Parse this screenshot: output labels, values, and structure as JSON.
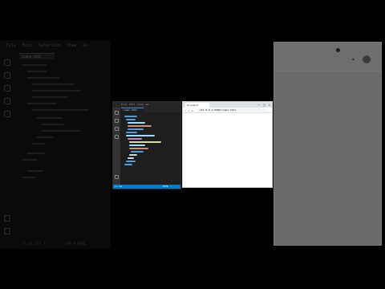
{
  "background_editor": {
    "menu": [
      "File",
      "Edit",
      "Selection",
      "View",
      "Go"
    ],
    "tab_label": "index.html",
    "status_left": "Ln 14, Col 5",
    "status_right": "UTF-8  HTML"
  },
  "code_window": {
    "menu": [
      "File",
      "Edit",
      "View",
      "Go"
    ],
    "tab_label": "index.html",
    "status_left": "Ln 14",
    "status_right": "HTML"
  },
  "browser": {
    "tab_title": "Document",
    "url": "127.0.0.1:5500/index.html",
    "window_controls": [
      "–",
      "□",
      "×"
    ],
    "nav_icons": [
      "back-icon",
      "forward-icon",
      "reload-icon"
    ]
  },
  "right_panel": {
    "mic_icon": "microphone-icon",
    "avatar": "avatar"
  },
  "colors": {
    "editor_bg": "#1e1e1e",
    "status_bar": "#007acc",
    "browser_tabstrip": "#dee1e6",
    "panel_gray": "#6a6a6a"
  }
}
